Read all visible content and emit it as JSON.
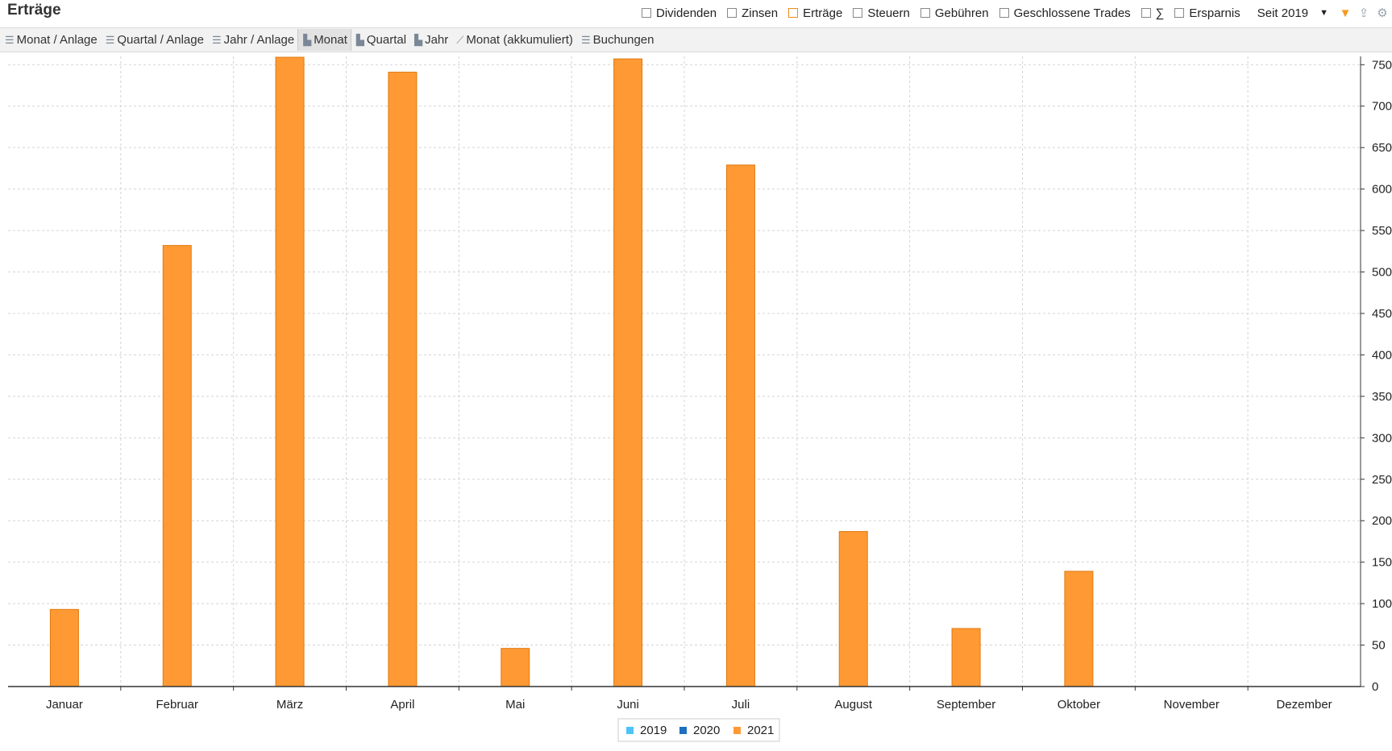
{
  "header": {
    "title": "Erträge",
    "filters": [
      {
        "label": "Dividenden",
        "checked": false
      },
      {
        "label": "Zinsen",
        "checked": false
      },
      {
        "label": "Erträge",
        "checked": false,
        "accent": "#f08a1c"
      },
      {
        "label": "Steuern",
        "checked": false
      },
      {
        "label": "Gebühren",
        "checked": false
      },
      {
        "label": "Geschlossene Trades",
        "checked": false
      },
      {
        "label": "∑",
        "checked": false
      },
      {
        "label": "Ersparnis",
        "checked": false
      }
    ],
    "period": "Seit 2019",
    "icons": [
      "filter-icon",
      "upload-icon",
      "gear-icon"
    ]
  },
  "toolbar": {
    "tabs": [
      {
        "label": "Monat / Anlage",
        "icon": "list-icon"
      },
      {
        "label": "Quartal / Anlage",
        "icon": "list-icon"
      },
      {
        "label": "Jahr / Anlage",
        "icon": "list-icon"
      },
      {
        "label": "Monat",
        "icon": "bar-chart-icon",
        "active": true
      },
      {
        "label": "Quartal",
        "icon": "bar-chart-icon"
      },
      {
        "label": "Jahr",
        "icon": "bar-chart-icon"
      },
      {
        "label": "Monat (akkumuliert)",
        "icon": "line-chart-icon"
      },
      {
        "label": "Buchungen",
        "icon": "list-icon"
      }
    ]
  },
  "chart_data": {
    "type": "bar",
    "categories": [
      "Januar",
      "Februar",
      "März",
      "April",
      "Mai",
      "Juni",
      "Juli",
      "August",
      "September",
      "Oktober",
      "November",
      "Dezember"
    ],
    "series": [
      {
        "name": "2019",
        "color": "#4fc3f7",
        "values": [
          0,
          0,
          0,
          0,
          0,
          0,
          0,
          0,
          0,
          0,
          0,
          0
        ]
      },
      {
        "name": "2020",
        "color": "#1f6fbf",
        "values": [
          0,
          0,
          0,
          0,
          0,
          0,
          0,
          0,
          0,
          0,
          0,
          0
        ]
      },
      {
        "name": "2021",
        "color": "#ff9933",
        "values": [
          93,
          532,
          759,
          741,
          46,
          757,
          629,
          187,
          70,
          139,
          0,
          0
        ]
      }
    ],
    "ylim": [
      0,
      760
    ],
    "yticks": [
      0,
      50,
      100,
      150,
      200,
      250,
      300,
      350,
      400,
      450,
      500,
      550,
      600,
      650,
      700,
      750
    ],
    "y_axis_position": "right",
    "grid": true,
    "legend_position": "bottom-center"
  }
}
